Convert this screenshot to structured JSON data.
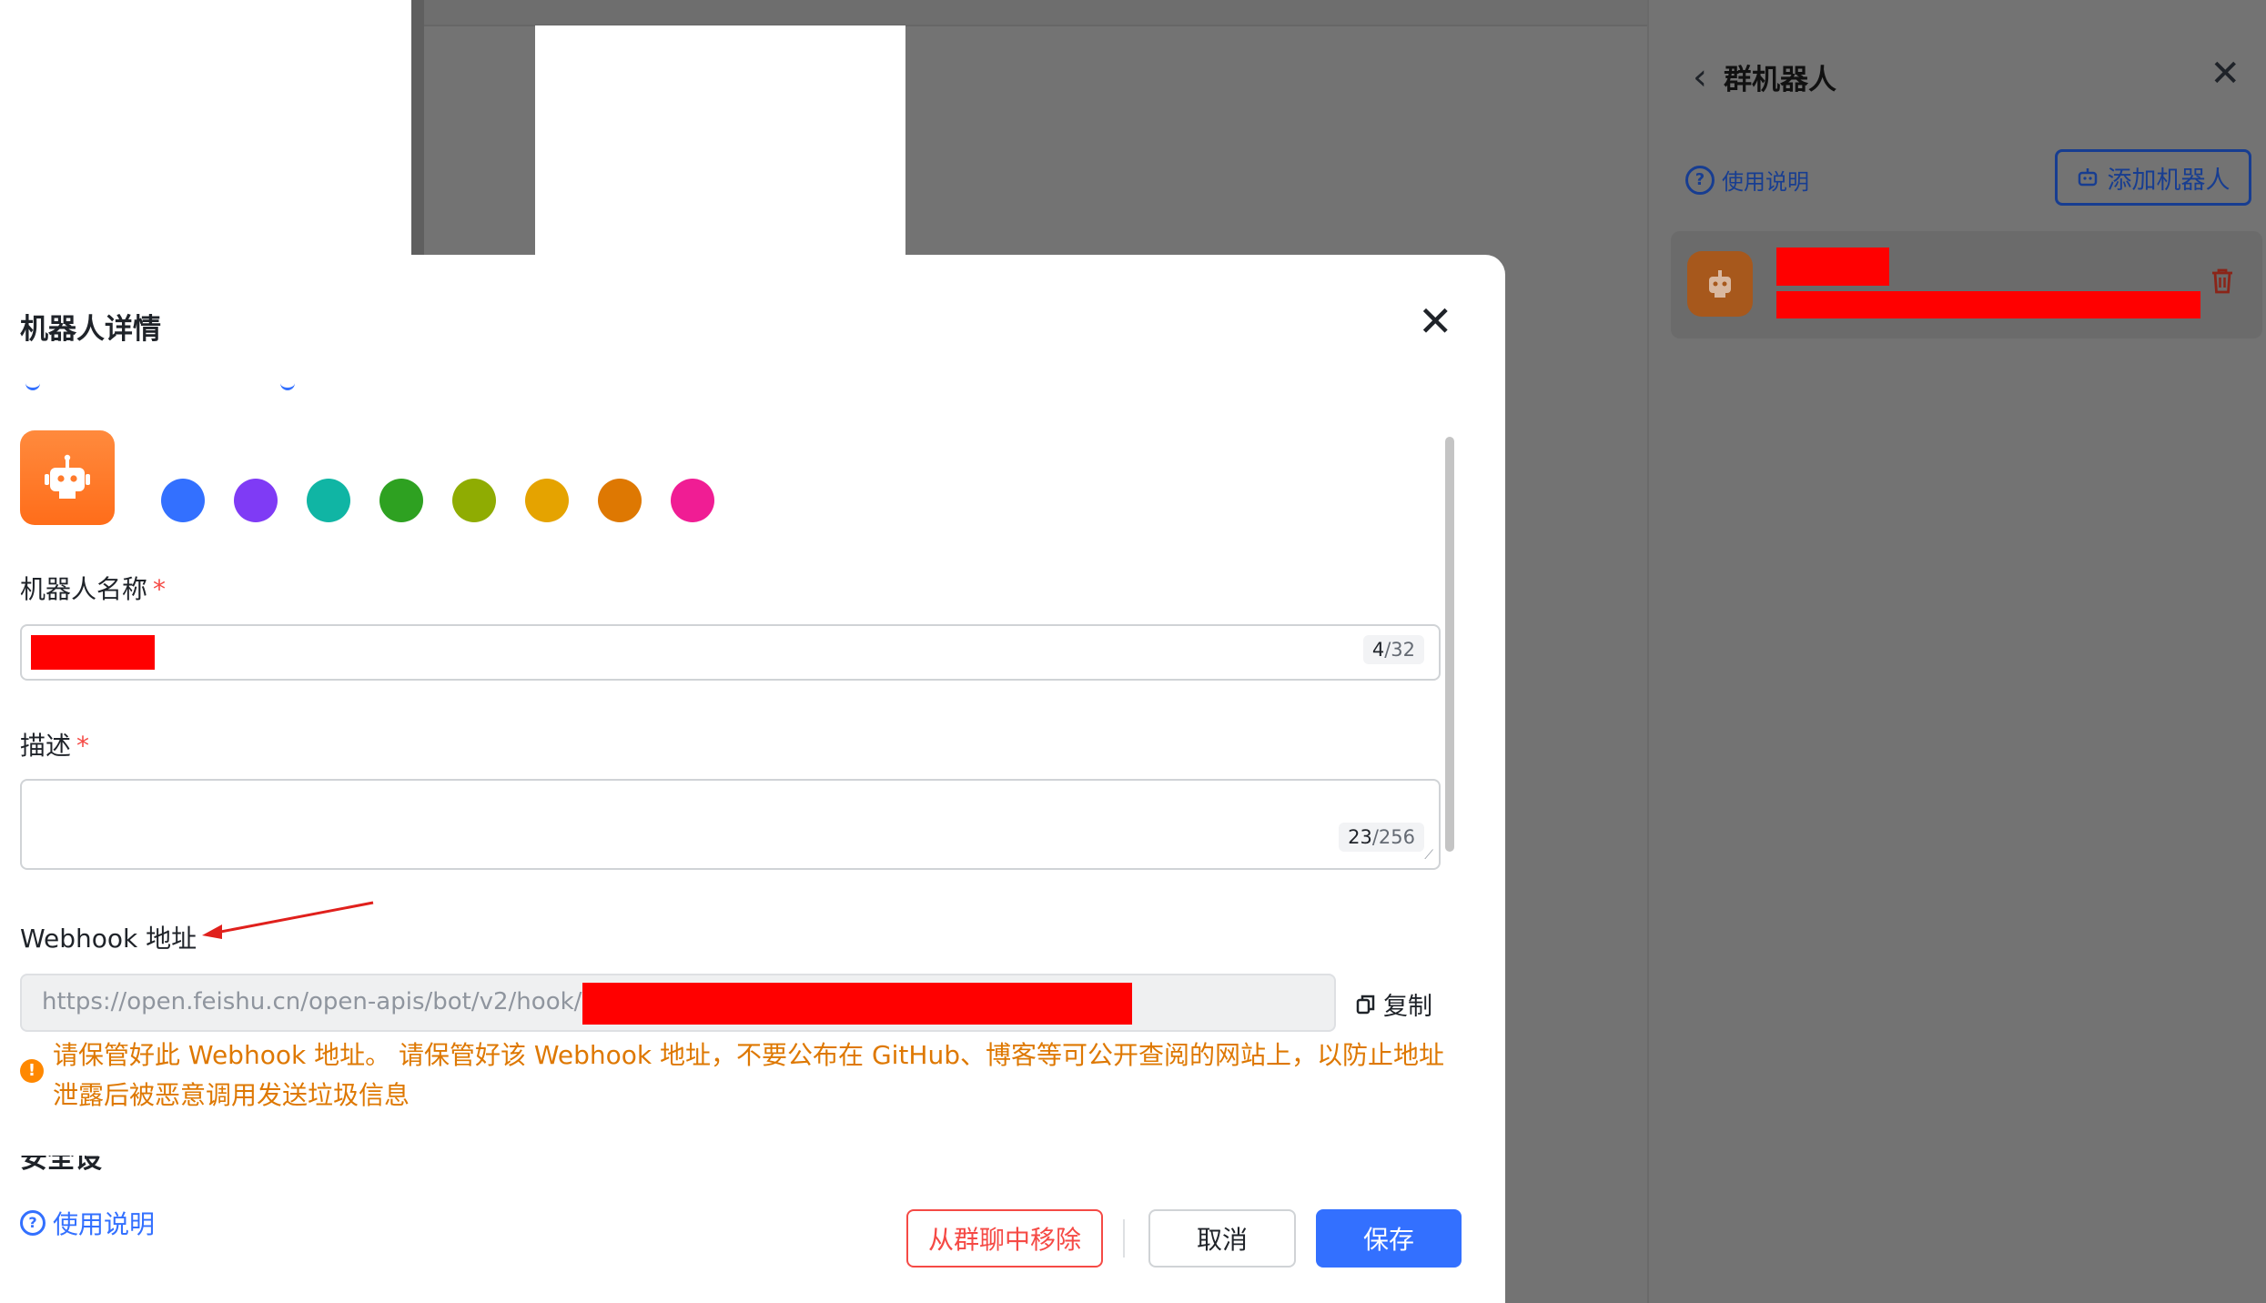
{
  "side_panel": {
    "title": "群机器人",
    "help_label": "使用说明",
    "add_bot_label": "添加机器人"
  },
  "dialog": {
    "title": "机器人详情",
    "color_options": [
      "#3370ff",
      "#7f3bf5",
      "#10b5a4",
      "#2ea121",
      "#8fac02",
      "#e5a300",
      "#de7802",
      "#f01d94"
    ],
    "name_field": {
      "label": "机器人名称",
      "required_mark": "*",
      "count_current": "4",
      "count_max": "/32"
    },
    "desc_field": {
      "label": "描述",
      "required_mark": "*",
      "count_current": "23",
      "count_max": "/256"
    },
    "webhook": {
      "label": "Webhook 地址",
      "url_prefix": "https://open.feishu.cn/open-apis/bot/v2/hook/",
      "copy_label": "复制",
      "warning": "请保管好此 Webhook 地址。 请保管好该 Webhook 地址，不要公布在 GitHub、博客等可公开查阅的网站上，以防止地址泄露后被恶意调用发送垃圾信息"
    },
    "footer": {
      "help_label": "使用说明",
      "remove_label": "从群聊中移除",
      "cancel_label": "取消",
      "save_label": "保存"
    }
  },
  "colors": {
    "primary": "#3370ff",
    "danger": "#f54a45",
    "warning": "#de7802",
    "overlay": "#737373"
  }
}
